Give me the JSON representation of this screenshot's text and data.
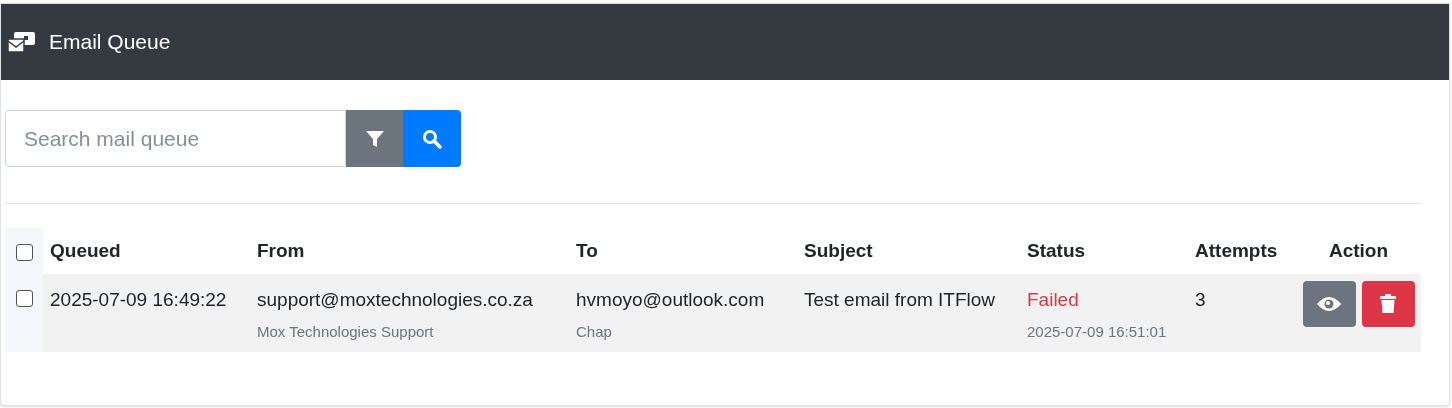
{
  "header": {
    "title": "Email Queue"
  },
  "search": {
    "placeholder": "Search mail queue"
  },
  "table": {
    "select_all": {
      "checked": false
    },
    "columns": [
      "Queued",
      "From",
      "To",
      "Subject",
      "Status",
      "Attempts",
      "Action"
    ],
    "rows": [
      {
        "checked": false,
        "queued": "2025-07-09 16:49:22",
        "from": "support@moxtechnologies.co.za",
        "from_name": "Mox Technologies Support",
        "to": "hvmoyo@outlook.com",
        "to_name": "Chap",
        "subject": "Test email from ITFlow",
        "status": "Failed",
        "failed": true,
        "status_time": "2025-07-09 16:51:01",
        "attempts": "3"
      }
    ]
  }
}
